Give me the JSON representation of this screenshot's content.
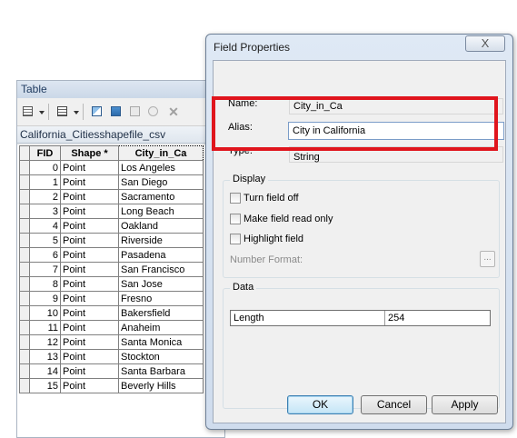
{
  "table_window": {
    "title": "Table",
    "tab_label": "California_Citiesshapefile_csv",
    "columns": [
      "FID",
      "Shape *",
      "City_in_Ca"
    ],
    "rows": [
      {
        "fid": "0",
        "shape": "Point",
        "city": "Los Angeles"
      },
      {
        "fid": "1",
        "shape": "Point",
        "city": "San Diego"
      },
      {
        "fid": "2",
        "shape": "Point",
        "city": "Sacramento"
      },
      {
        "fid": "3",
        "shape": "Point",
        "city": "Long Beach"
      },
      {
        "fid": "4",
        "shape": "Point",
        "city": "Oakland"
      },
      {
        "fid": "5",
        "shape": "Point",
        "city": "Riverside"
      },
      {
        "fid": "6",
        "shape": "Point",
        "city": "Pasadena"
      },
      {
        "fid": "7",
        "shape": "Point",
        "city": "San Francisco"
      },
      {
        "fid": "8",
        "shape": "Point",
        "city": "San Jose"
      },
      {
        "fid": "9",
        "shape": "Point",
        "city": "Fresno"
      },
      {
        "fid": "10",
        "shape": "Point",
        "city": "Bakersfield"
      },
      {
        "fid": "11",
        "shape": "Point",
        "city": "Anaheim"
      },
      {
        "fid": "12",
        "shape": "Point",
        "city": "Santa Monica"
      },
      {
        "fid": "13",
        "shape": "Point",
        "city": "Stockton"
      },
      {
        "fid": "14",
        "shape": "Point",
        "city": "Santa Barbara"
      },
      {
        "fid": "15",
        "shape": "Point",
        "city": "Beverly Hills"
      }
    ],
    "toolbar_icons": [
      "table-options-icon",
      "related-tables-icon",
      "select-by-attributes-icon",
      "switch-selection-icon",
      "clear-selection-icon",
      "zoom-to-selected-icon",
      "delete-selected-icon"
    ]
  },
  "dialog": {
    "title": "Field Properties",
    "close_glyph": "X",
    "name_label": "Name:",
    "name_value": "City_in_Ca",
    "alias_label": "Alias:",
    "alias_value": "City in California",
    "type_label": "Type:",
    "type_value": "String",
    "display_group_title": "Display",
    "turn_field_off_label": "Turn field off",
    "read_only_label": "Make field read only",
    "highlight_label": "Highlight field",
    "number_format_label": "Number Format:",
    "number_format_button": "...",
    "data_group_title": "Data",
    "data_key": "Length",
    "data_value": "254",
    "ok_label": "OK",
    "cancel_label": "Cancel",
    "apply_label": "Apply",
    "highlight_color": "#e0151d"
  }
}
